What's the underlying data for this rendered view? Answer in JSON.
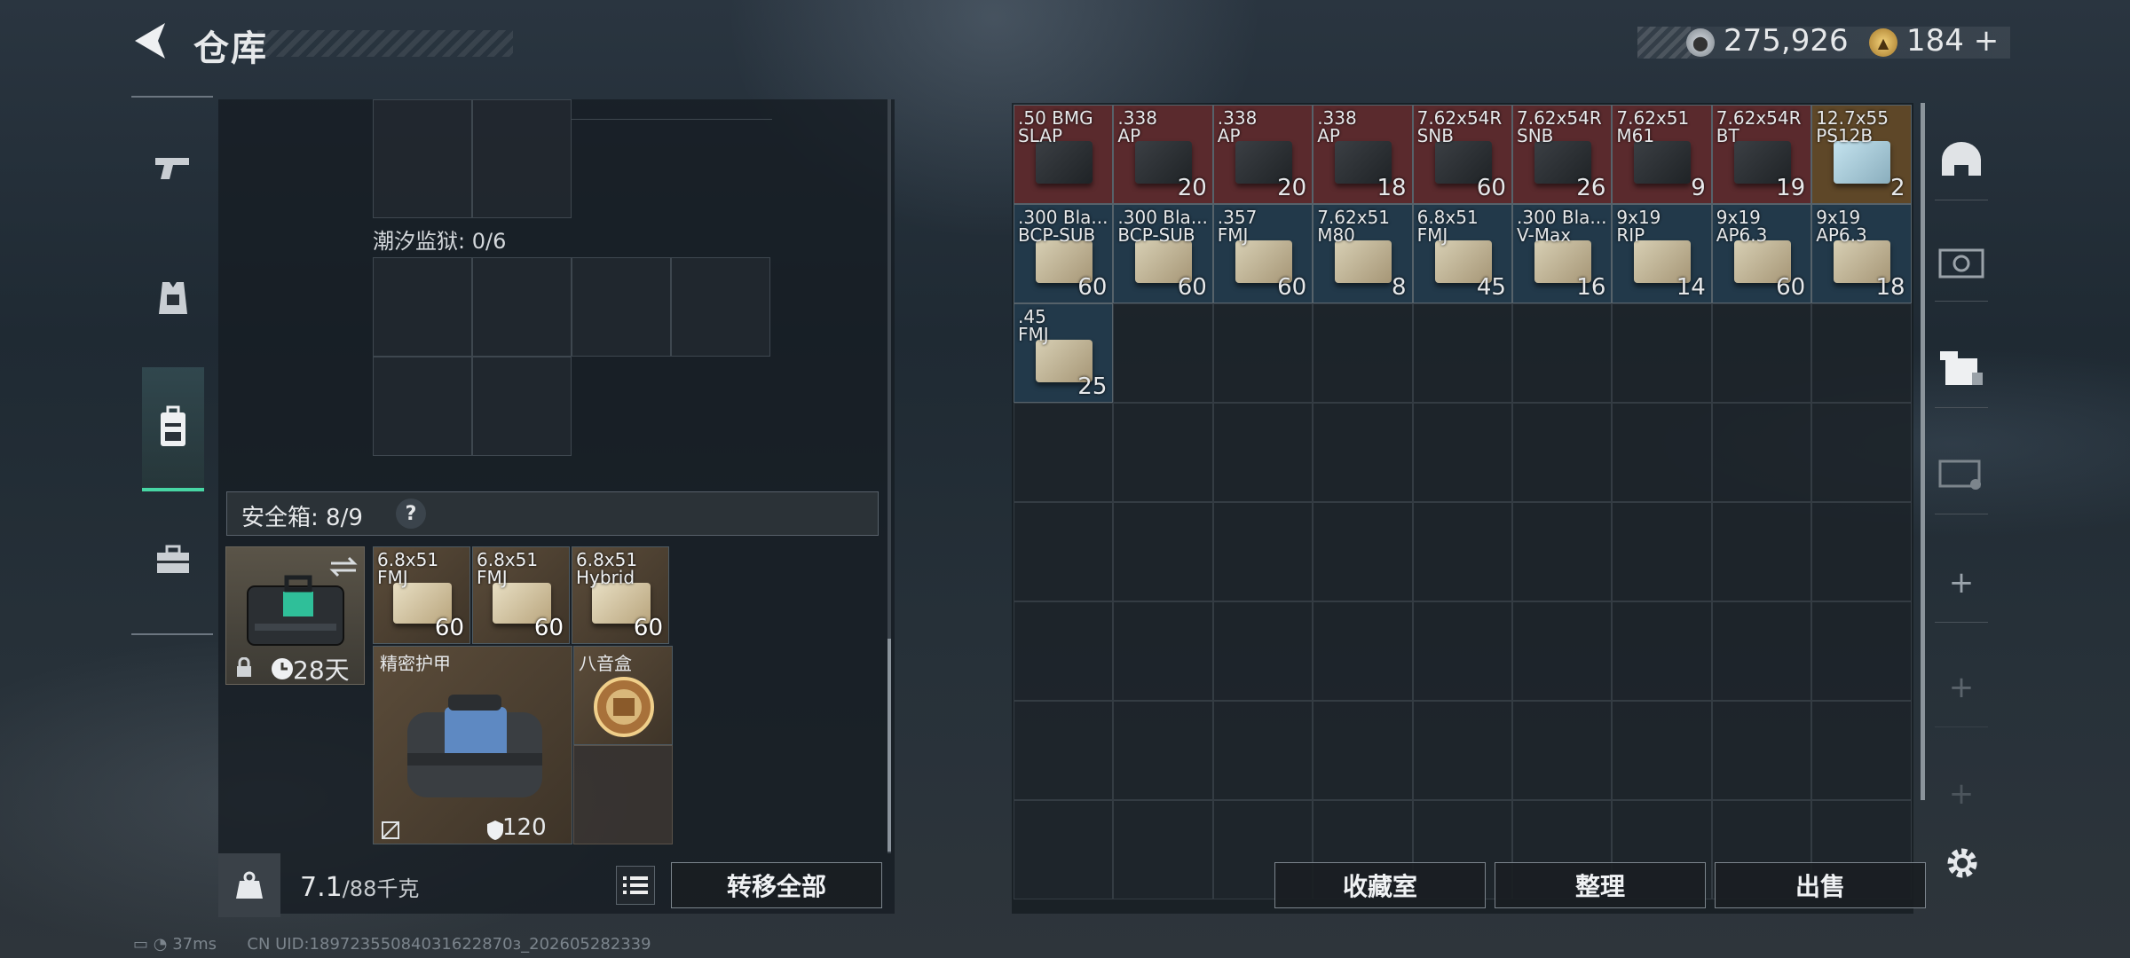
{
  "header": {
    "title": "仓库",
    "silver": "275,926",
    "gold": "184",
    "gold_plus": "+"
  },
  "left_tabs": [
    "weapons-tab",
    "gear-tab",
    "backpack-tab",
    "tools-tab"
  ],
  "stash_section": {
    "tide_prison_label": "潮汐监狱: 0/6"
  },
  "safe_box": {
    "label": "安全箱: 8/9",
    "help": "?",
    "days": "28天"
  },
  "safe_items": [
    {
      "line1": "6.8x51",
      "line2": "FMJ",
      "count": "60",
      "color": "tan"
    },
    {
      "line1": "6.8x51",
      "line2": "FMJ",
      "count": "60",
      "color": "tan"
    },
    {
      "line1": "6.8x51",
      "line2": "Hybrid",
      "count": "60",
      "color": "tan"
    }
  ],
  "armor": {
    "label": "精密护甲",
    "durability": "120"
  },
  "music_box": {
    "label": "八音盒"
  },
  "weight": {
    "value": "7.1",
    "max": "/88千克"
  },
  "buttons": {
    "transfer_all": "转移全部",
    "vault": "收藏室",
    "sort": "整理",
    "sell": "出售"
  },
  "inventory": [
    {
      "line1": ".50 BMG",
      "line2": "SLAP",
      "count": "",
      "color": "red"
    },
    {
      "line1": ".338",
      "line2": "AP",
      "count": "20",
      "color": "red"
    },
    {
      "line1": ".338",
      "line2": "AP",
      "count": "20",
      "color": "red"
    },
    {
      "line1": ".338",
      "line2": "AP",
      "count": "18",
      "color": "red"
    },
    {
      "line1": "7.62x54R",
      "line2": "SNB",
      "count": "60",
      "color": "red"
    },
    {
      "line1": "7.62x54R",
      "line2": "SNB",
      "count": "26",
      "color": "red"
    },
    {
      "line1": "7.62x51",
      "line2": "M61",
      "count": "9",
      "color": "red"
    },
    {
      "line1": "7.62x54R",
      "line2": "BT",
      "count": "19",
      "color": "red"
    },
    {
      "line1": "12.7x55",
      "line2": "PS12B",
      "count": "2",
      "color": "gold"
    },
    {
      "line1": ".300 Bla...",
      "line2": "BCP-SUB",
      "count": "60",
      "color": "blue"
    },
    {
      "line1": ".300 Bla...",
      "line2": "BCP-SUB",
      "count": "60",
      "color": "blue"
    },
    {
      "line1": ".357",
      "line2": "FMJ",
      "count": "60",
      "color": "blue"
    },
    {
      "line1": "7.62x51",
      "line2": "M80",
      "count": "8",
      "color": "blue"
    },
    {
      "line1": "6.8x51",
      "line2": "FMJ",
      "count": "45",
      "color": "blue"
    },
    {
      "line1": ".300 Bla...",
      "line2": "V-Max",
      "count": "16",
      "color": "blue"
    },
    {
      "line1": "9x19",
      "line2": "RIP",
      "count": "14",
      "color": "blue"
    },
    {
      "line1": "9x19",
      "line2": "AP6.3",
      "count": "60",
      "color": "blue"
    },
    {
      "line1": "9x19",
      "line2": "AP6.3",
      "count": "18",
      "color": "blue"
    },
    {
      "line1": ".45",
      "line2": "FMJ",
      "count": "25",
      "color": "blue"
    }
  ],
  "status": {
    "ping": "37ms",
    "uid": "CN UID:18972355084031622870з_202605282339"
  },
  "colors": {
    "accent_green": "#47d6a4",
    "red_tile": "#5b2a2c",
    "blue_tile": "#22394a",
    "gold_tile": "#5e4728"
  }
}
